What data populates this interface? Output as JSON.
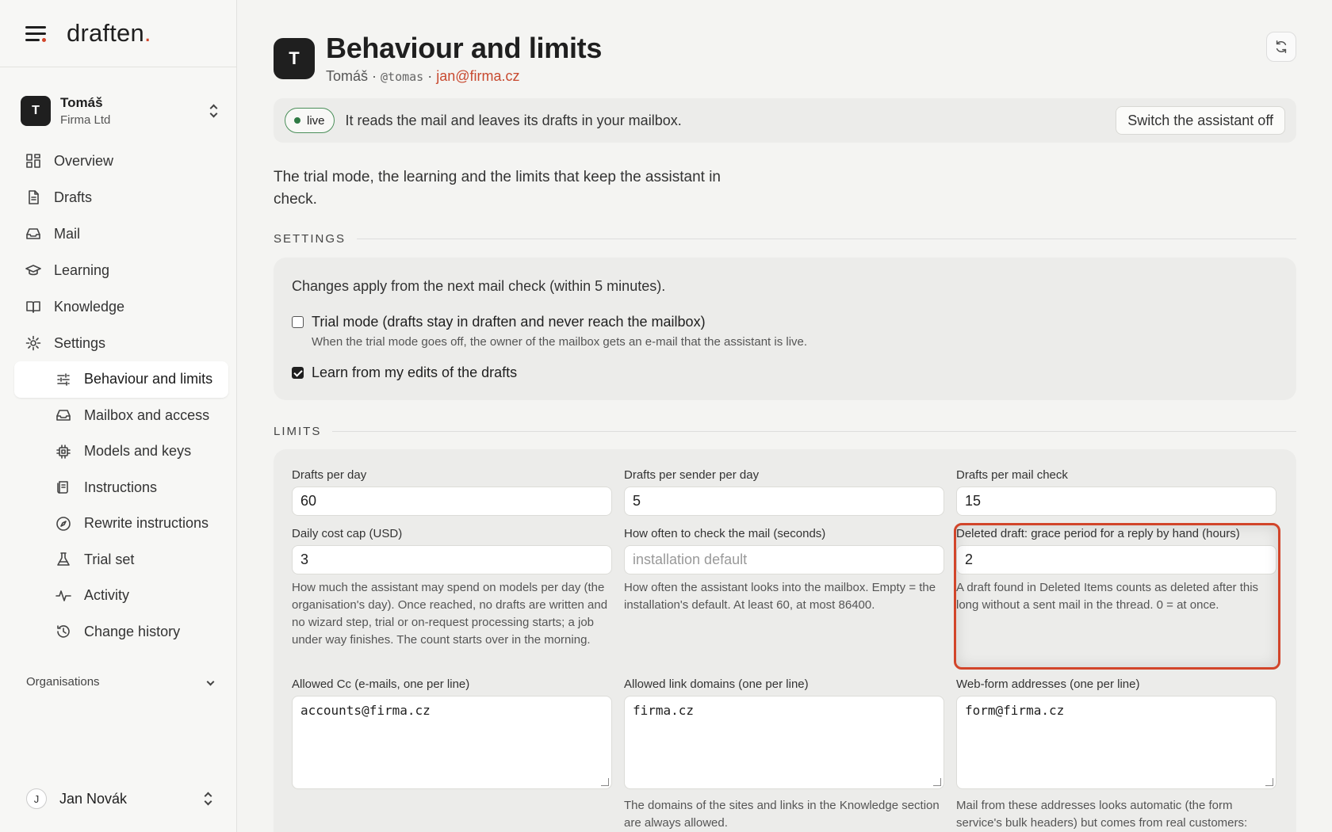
{
  "brand": {
    "name": "draften",
    "dot": "."
  },
  "account": {
    "initial": "T",
    "name": "Tomáš",
    "org": "Firma Ltd"
  },
  "nav": {
    "overview": "Overview",
    "drafts": "Drafts",
    "mail": "Mail",
    "learning": "Learning",
    "knowledge": "Knowledge",
    "settings": "Settings",
    "sub": {
      "behaviour": "Behaviour and limits",
      "mailbox": "Mailbox and access",
      "models": "Models and keys",
      "instructions": "Instructions",
      "rewrite": "Rewrite instructions",
      "trial": "Trial set",
      "activity": "Activity",
      "history": "Change history"
    }
  },
  "organisations_label": "Organisations",
  "user": {
    "initial": "J",
    "name": "Jan Novák"
  },
  "header": {
    "initial": "T",
    "title": "Behaviour and limits",
    "name": "Tomáš",
    "sep1": " · ",
    "handle": "@tomas",
    "sep2": " · ",
    "email": "jan@firma.cz"
  },
  "status": {
    "badge": "live",
    "text": "It reads the mail and leaves its drafts in your mailbox.",
    "switch_label": "Switch the assistant off"
  },
  "intro": "The trial mode, the learning and the limits that keep the assistant in check.",
  "settings": {
    "section_label": "SETTINGS",
    "note": "Changes apply from the next mail check (within 5 minutes).",
    "trial_mode": {
      "label": "Trial mode (drafts stay in draften and never reach the mailbox)",
      "help": "When the trial mode goes off, the owner of the mailbox gets an e-mail that the assistant is live.",
      "checked": false
    },
    "learn": {
      "label": "Learn from my edits of the drafts",
      "checked": true
    }
  },
  "limits": {
    "section_label": "LIMITS",
    "drafts_per_day": {
      "label": "Drafts per day",
      "value": "60"
    },
    "drafts_per_sender": {
      "label": "Drafts per sender per day",
      "value": "5"
    },
    "drafts_per_check": {
      "label": "Drafts per mail check",
      "value": "15"
    },
    "daily_cost": {
      "label": "Daily cost cap (USD)",
      "value": "3",
      "help": "How much the assistant may spend on models per day (the organisation's day). Once reached, no drafts are written and no wizard step, trial or on-request processing starts; a job under way finishes. The count starts over in the morning."
    },
    "check_interval": {
      "label": "How often to check the mail (seconds)",
      "placeholder": "installation default",
      "help": "How often the assistant looks into the mailbox. Empty = the installation's default. At least 60, at most 86400."
    },
    "grace_period": {
      "label": "Deleted draft: grace period for a reply by hand (hours)",
      "value": "2",
      "help": "A draft found in Deleted Items counts as deleted after this long without a sent mail in the thread. 0 = at once."
    },
    "allowed_cc": {
      "label": "Allowed Cc (e-mails, one per line)",
      "value": "accounts@firma.cz"
    },
    "link_domains": {
      "label": "Allowed link domains (one per line)",
      "value": "firma.cz",
      "help": "The domains of the sites and links in the Knowledge section are always allowed."
    },
    "webform": {
      "label": "Web-form addresses (one per line)",
      "value": "form@firma.cz",
      "help": "Mail from these addresses looks automatic (the form service's bulk headers) but comes from real customers:"
    }
  }
}
